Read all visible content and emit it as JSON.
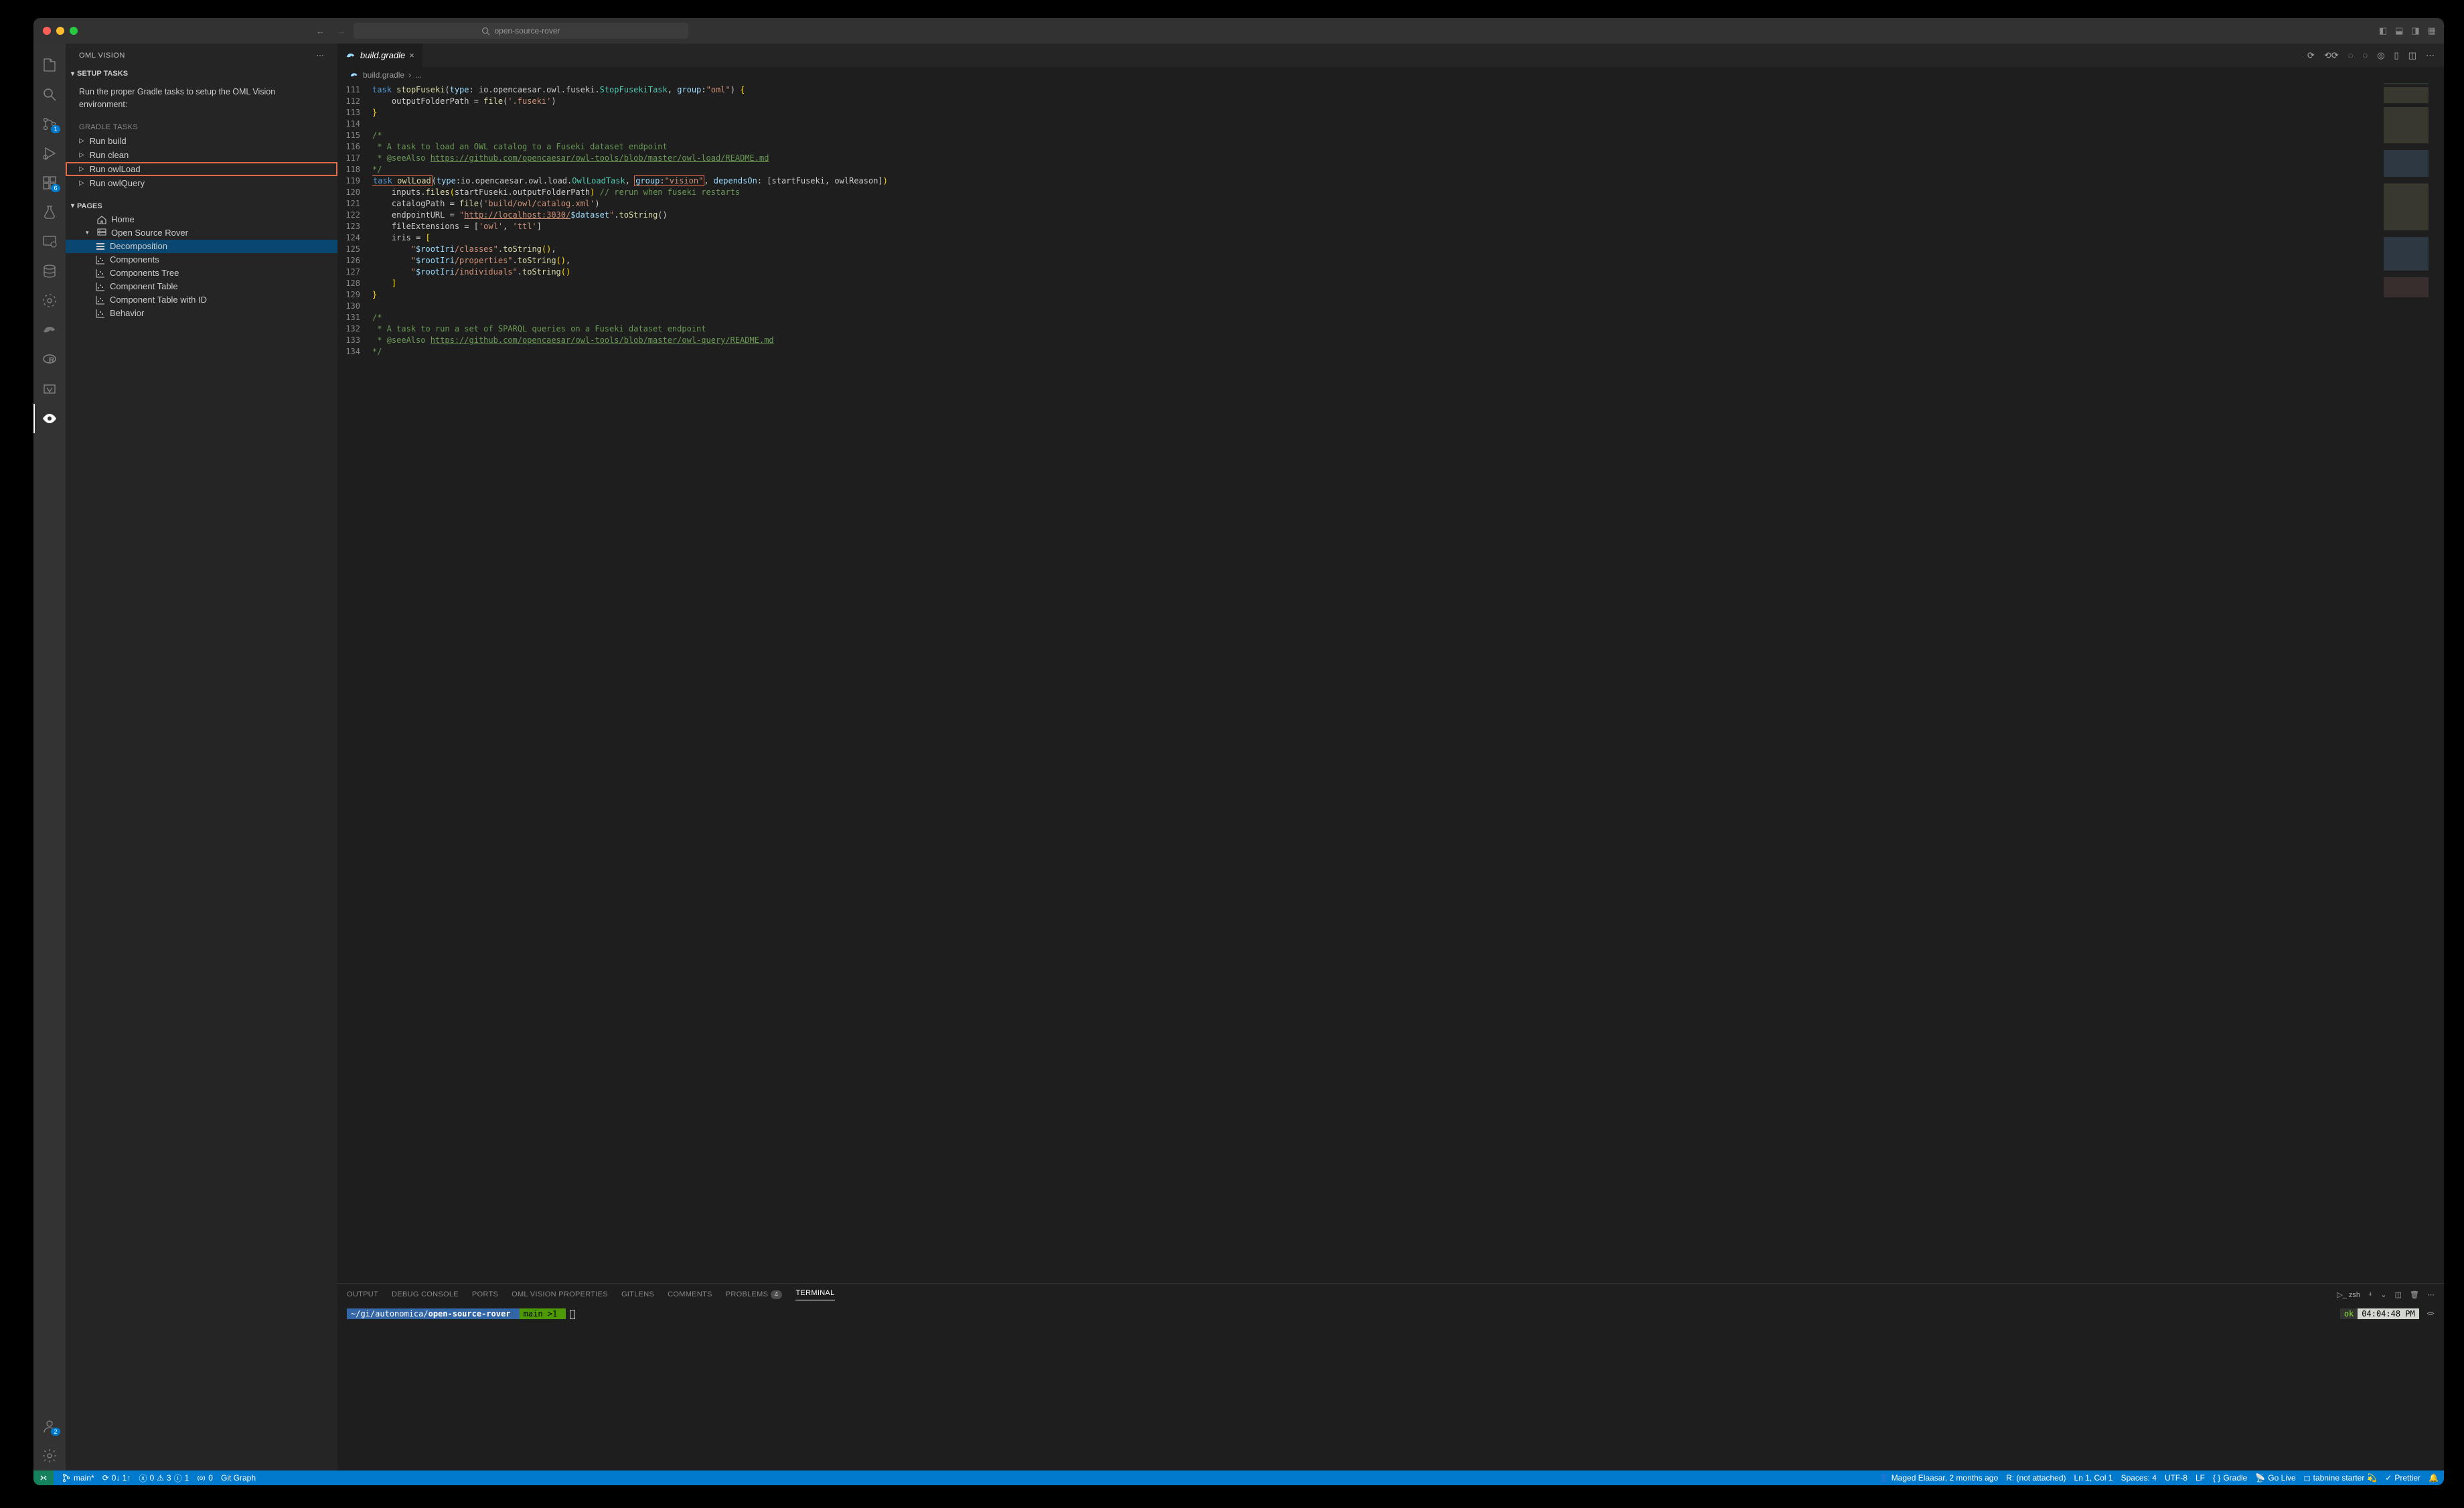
{
  "titlebar": {
    "search_placeholder": "open-source-rover"
  },
  "sidebar": {
    "title": "OML VISION",
    "setup_section": "SETUP TASKS",
    "setup_text": "Run the proper Gradle tasks to setup the OML Vision environment:",
    "gradle_label": "GRADLE TASKS",
    "tasks": [
      {
        "label": "Run build"
      },
      {
        "label": "Run clean"
      },
      {
        "label": "Run owlLoad"
      },
      {
        "label": "Run owlQuery"
      }
    ],
    "pages_section": "PAGES",
    "pages": {
      "home": "Home",
      "rover": "Open Source Rover",
      "children": [
        "Decomposition",
        "Components",
        "Components Tree",
        "Component Table",
        "Component Table with ID",
        "Behavior"
      ]
    }
  },
  "tab": {
    "filename": "build.gradle"
  },
  "breadcrumb": {
    "file": "build.gradle",
    "more": "..."
  },
  "code": {
    "line_start": 111,
    "lines": [
      "task stopFuseki(type: io.opencaesar.owl.fuseki.StopFusekiTask, group:\"oml\") {",
      "    outputFolderPath = file('.fuseki')",
      "}",
      "",
      "/*",
      " * A task to load an OWL catalog to a Fuseki dataset endpoint",
      " * @seeAlso https://github.com/opencaesar/owl-tools/blob/master/owl-load/README.md",
      "*/",
      "task owlLoad(type:io.opencaesar.owl.load.OwlLoadTask, group:\"vision\", dependsOn: [startFuseki, owlReason])",
      "    inputs.files(startFuseki.outputFolderPath) // rerun when fuseki restarts",
      "    catalogPath = file('build/owl/catalog.xml')",
      "    endpointURL = \"http://localhost:3030/$dataset\".toString()",
      "    fileExtensions = ['owl', 'ttl']",
      "    iris = [",
      "        \"$rootIri/classes\".toString(),",
      "        \"$rootIri/properties\".toString(),",
      "        \"$rootIri/individuals\".toString()",
      "    ]",
      "}",
      "",
      "/*",
      " * A task to run a set of SPARQL queries on a Fuseki dataset endpoint",
      " * @seeAlso https://github.com/opencaesar/owl-tools/blob/master/owl-query/README.md",
      "*/"
    ]
  },
  "panel": {
    "tabs": [
      "OUTPUT",
      "DEBUG CONSOLE",
      "PORTS",
      "OML VISION PROPERTIES",
      "GITLENS",
      "COMMENTS",
      "PROBLEMS",
      "TERMINAL"
    ],
    "problems_badge": "4",
    "shell": "zsh"
  },
  "terminal": {
    "path_prefix": "~/gi/autonomica/",
    "path_bold": "open-source-rover",
    "branch": "main >1",
    "status": "ok",
    "time": "04:04:48 PM"
  },
  "statusbar": {
    "branch": "main*",
    "sync": "0↓ 1↑",
    "errors": "0",
    "warnings": "3",
    "info": "1",
    "ports": "0",
    "gitgraph": "Git Graph",
    "blame": "Maged Elaasar, 2 months ago",
    "r_status": "R: (not attached)",
    "cursor": "Ln 1, Col 1",
    "spaces": "Spaces: 4",
    "encoding": "UTF-8",
    "eol": "LF",
    "lang": "Gradle",
    "golive": "Go Live",
    "tabnine": "tabnine starter",
    "prettier": "Prettier"
  },
  "activity_badges": {
    "scm": "1",
    "ext": "6",
    "account": "2"
  }
}
